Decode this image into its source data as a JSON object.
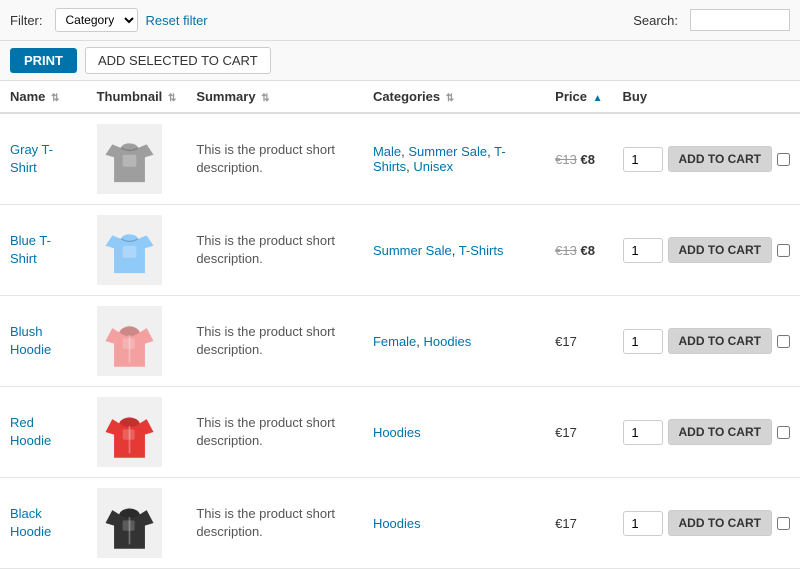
{
  "toolbar": {
    "filter_label": "Filter:",
    "category_placeholder": "Category",
    "reset_label": "Reset filter",
    "search_label": "Search:"
  },
  "actions": {
    "print_label": "PRINT",
    "add_selected_label": "ADD SELECTED TO CART"
  },
  "table": {
    "columns": [
      {
        "key": "name",
        "label": "Name",
        "sortable": true
      },
      {
        "key": "thumbnail",
        "label": "Thumbnail",
        "sortable": true
      },
      {
        "key": "summary",
        "label": "Summary",
        "sortable": true
      },
      {
        "key": "categories",
        "label": "Categories",
        "sortable": true
      },
      {
        "key": "price",
        "label": "Price",
        "sortable": true
      },
      {
        "key": "buy",
        "label": "Buy",
        "sortable": false
      }
    ],
    "rows": [
      {
        "id": 1,
        "name": "Gray T-Shirt",
        "thumbnail_type": "gray-tshirt",
        "summary": "This is the product short description.",
        "categories": [
          {
            "label": "Male",
            "href": "#"
          },
          {
            "label": "Summer Sale",
            "href": "#"
          },
          {
            "label": "T-Shirts",
            "href": "#"
          },
          {
            "label": "Unisex",
            "href": "#"
          }
        ],
        "price_original": "€13",
        "price_sale": "€8",
        "has_sale": true,
        "qty": "1",
        "add_to_cart": "ADD TO CART"
      },
      {
        "id": 2,
        "name": "Blue T-Shirt",
        "thumbnail_type": "blue-tshirt",
        "summary": "This is the product short description.",
        "categories": [
          {
            "label": "Summer Sale",
            "href": "#"
          },
          {
            "label": "T-Shirts",
            "href": "#"
          }
        ],
        "price_original": "€13",
        "price_sale": "€8",
        "has_sale": true,
        "qty": "1",
        "add_to_cart": "ADD TO CART"
      },
      {
        "id": 3,
        "name": "Blush Hoodie",
        "thumbnail_type": "blush-hoodie",
        "summary": "This is the product short description.",
        "categories": [
          {
            "label": "Female",
            "href": "#"
          },
          {
            "label": "Hoodies",
            "href": "#"
          }
        ],
        "price_original": null,
        "price_sale": null,
        "price_regular": "€17",
        "has_sale": false,
        "qty": "1",
        "add_to_cart": "ADD TO CART"
      },
      {
        "id": 4,
        "name": "Red Hoodie",
        "thumbnail_type": "red-hoodie",
        "summary": "This is the product short description.",
        "categories": [
          {
            "label": "Hoodies",
            "href": "#"
          }
        ],
        "price_original": null,
        "price_sale": null,
        "price_regular": "€17",
        "has_sale": false,
        "qty": "1",
        "add_to_cart": "ADD TO CART"
      },
      {
        "id": 5,
        "name": "Black Hoodie",
        "thumbnail_type": "black-hoodie",
        "summary": "This is the product short description.",
        "categories": [
          {
            "label": "Hoodies",
            "href": "#"
          }
        ],
        "price_original": null,
        "price_sale": null,
        "price_regular": "€17",
        "has_sale": false,
        "qty": "1",
        "add_to_cart": "ADD TO CART"
      }
    ]
  }
}
